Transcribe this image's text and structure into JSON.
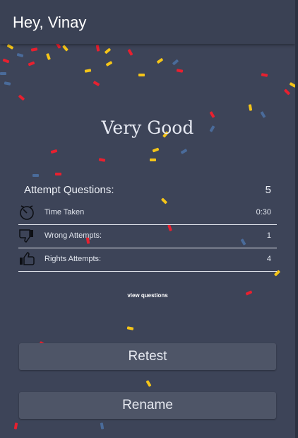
{
  "appbar": {
    "title": "Hey, Vinay"
  },
  "result": {
    "title": "Very Good"
  },
  "summary": {
    "label": "Attempt Questions:",
    "value": "5"
  },
  "rows": [
    {
      "icon": "stopwatch-icon",
      "label": "Time Taken",
      "value": "0:30"
    },
    {
      "icon": "thumbs-down-icon",
      "label": "Wrong Attempts:",
      "value": "1"
    },
    {
      "icon": "thumbs-up-icon",
      "label": "Rights Attempts:",
      "value": "4"
    }
  ],
  "links": {
    "view_questions": "view questions"
  },
  "buttons": {
    "retest": "Retest",
    "rename": "Rename"
  },
  "colors": {
    "background": "#3d4458",
    "appbar": "#3a4154",
    "button": "#4e5567",
    "confetti_red": "#e8202f",
    "confetti_yellow": "#f5c518",
    "confetti_blue": "#4a6b9a"
  }
}
